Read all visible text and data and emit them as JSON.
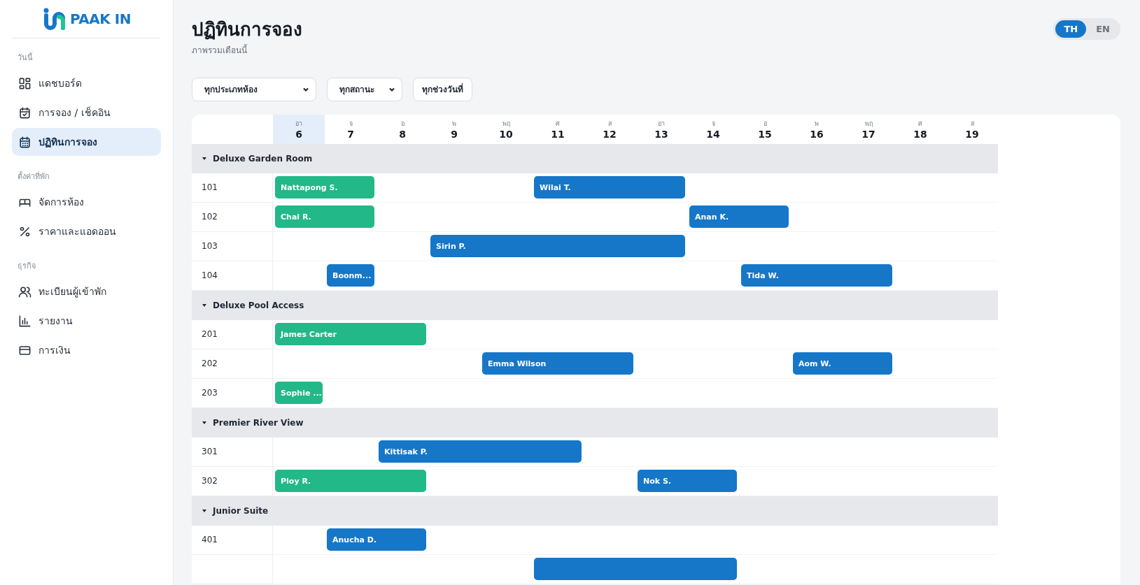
{
  "sidebar": {
    "logo": "PAAK IN",
    "sections": [
      {
        "heading": "วันนี้",
        "items": [
          {
            "label": "แดชบอร์ด",
            "selected": false
          },
          {
            "label": "การจอง / เช็คอิน",
            "selected": false
          },
          {
            "label": "ปฏิทินการจอง",
            "selected": true
          }
        ]
      },
      {
        "heading": "ตั้งค่าที่พัก",
        "items": [
          {
            "label": "จัดการห้อง",
            "selected": false
          },
          {
            "label": "ราคาและแอดออน",
            "selected": false
          }
        ]
      },
      {
        "heading": "ธุรกิจ",
        "items": [
          {
            "label": "ทะเบียนผู้เข้าพัก",
            "selected": false
          },
          {
            "label": "รายงาน",
            "selected": false
          },
          {
            "label": "การเงิน",
            "selected": false
          }
        ]
      }
    ]
  },
  "header": {
    "title": "ปฏิทินการจอง",
    "subtitle": "ภาพรวมเดือนนี้"
  },
  "languages": [
    {
      "label": "TH",
      "selected": true
    },
    {
      "label": "EN",
      "selected": false
    }
  ],
  "filters": [
    {
      "label": "ทุกประเภทห้อง",
      "kind": "dropdown"
    },
    {
      "label": "ทุกสถานะ",
      "kind": "dropdown"
    },
    {
      "label": "ทุกช่วงวันที่",
      "kind": "button"
    }
  ],
  "days": [
    {
      "weekday": "อา",
      "date": "6",
      "today": true
    },
    {
      "weekday": "จ",
      "date": "7",
      "today": false
    },
    {
      "weekday": "อ",
      "date": "8",
      "today": false
    },
    {
      "weekday": "พ",
      "date": "9",
      "today": false
    },
    {
      "weekday": "พฤ",
      "date": "10",
      "today": false
    },
    {
      "weekday": "ศ",
      "date": "11",
      "today": false
    },
    {
      "weekday": "ส",
      "date": "12",
      "today": false
    },
    {
      "weekday": "อา",
      "date": "13",
      "today": false
    },
    {
      "weekday": "จ",
      "date": "14",
      "today": false
    },
    {
      "weekday": "อ",
      "date": "15",
      "today": false
    },
    {
      "weekday": "พ",
      "date": "16",
      "today": false
    },
    {
      "weekday": "พฤ",
      "date": "17",
      "today": false
    },
    {
      "weekday": "ศ",
      "date": "18",
      "today": false
    },
    {
      "weekday": "ส",
      "date": "19",
      "today": false
    }
  ],
  "groups": [
    {
      "name": "Deluxe Garden Room",
      "expanded": true,
      "rooms": [
        {
          "room": "101",
          "bookings": [
            {
              "guest": "Nattapong S.",
              "color": "#22b888"
            },
            {
              "guest": "Wilai T.",
              "color": "#1677c9"
            }
          ]
        },
        {
          "room": "102",
          "bookings": [
            {
              "guest": "Chai R.",
              "color": "#22b888"
            },
            {
              "guest": "Anan K.",
              "color": "#1677c9"
            }
          ]
        },
        {
          "room": "103",
          "bookings": [
            {
              "guest": "Sirin P.",
              "color": "#1677c9"
            }
          ]
        },
        {
          "room": "104",
          "bookings": [
            {
              "guest": "Boonm...",
              "color": "#1677c9"
            },
            {
              "guest": "Tida W.",
              "color": "#1677c9"
            }
          ]
        }
      ]
    },
    {
      "name": "Deluxe Pool Access",
      "expanded": true,
      "rooms": [
        {
          "room": "201",
          "bookings": [
            {
              "guest": "James Carter",
              "color": "#22b888"
            }
          ]
        },
        {
          "room": "202",
          "bookings": [
            {
              "guest": "Emma Wilson",
              "color": "#1677c9"
            },
            {
              "guest": "Aom W.",
              "color": "#1677c9"
            }
          ]
        },
        {
          "room": "203",
          "bookings": [
            {
              "guest": "Sophie ...",
              "color": "#22b888"
            }
          ]
        }
      ]
    },
    {
      "name": "Premier River View",
      "expanded": true,
      "rooms": [
        {
          "room": "301",
          "bookings": [
            {
              "guest": "Kittisak P.",
              "color": "#1677c9"
            }
          ]
        },
        {
          "room": "302",
          "bookings": [
            {
              "guest": "Ploy R.",
              "color": "#22b888"
            },
            {
              "guest": "Nok S.",
              "color": "#1677c9"
            }
          ]
        }
      ]
    },
    {
      "name": "Junior Suite",
      "expanded": true,
      "rooms": [
        {
          "room": "401",
          "bookings": [
            {
              "guest": "Anucha D.",
              "color": "#1677c9"
            }
          ]
        },
        {
          "bookings": [
            {
              "color": "#1677c9"
            }
          ]
        }
      ]
    }
  ]
}
